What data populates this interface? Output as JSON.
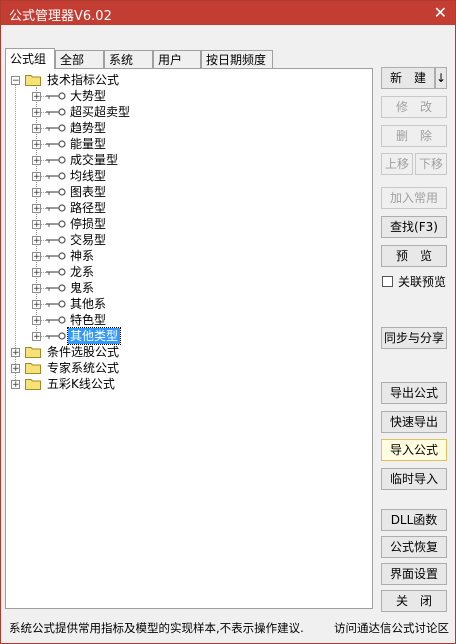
{
  "window": {
    "title": "公式管理器V6.02",
    "close_glyph": "✕"
  },
  "tabs": [
    {
      "label": "公式组",
      "active": true
    },
    {
      "label": "全部",
      "active": false
    },
    {
      "label": "系统",
      "active": false
    },
    {
      "label": "用户",
      "active": false
    },
    {
      "label": "按日期频度",
      "active": false
    }
  ],
  "tree": {
    "expanded_glyph": "−",
    "collapsed_glyph": "+",
    "groups": [
      {
        "label": "技术指标公式",
        "expanded": true,
        "children": [
          "大势型",
          "超买超卖型",
          "趋势型",
          "能量型",
          "成交量型",
          "均线型",
          "图表型",
          "路径型",
          "停损型",
          "交易型",
          "神系",
          "龙系",
          "鬼系",
          "其他系",
          "特色型",
          "其他类型"
        ],
        "selected_child": "其他类型"
      },
      {
        "label": "条件选股公式",
        "expanded": false
      },
      {
        "label": "专家系统公式",
        "expanded": false
      },
      {
        "label": "五彩K线公式",
        "expanded": false
      }
    ]
  },
  "buttons": {
    "new": "新　建",
    "new_arrow": "↓",
    "edit": "修　改",
    "delete": "删　除",
    "move_up": "上移",
    "move_down": "下移",
    "add_common": "加入常用",
    "find": "查找(F3)",
    "preview": "预　览",
    "link_preview_label": "关联预览",
    "sync_share": "同步与分享",
    "export": "导出公式",
    "quick_export": "快速导出",
    "import": "导入公式",
    "temp_import": "临时导入",
    "dll": "DLL函数",
    "restore": "公式恢复",
    "ui_settings": "界面设置",
    "close": "关　闭"
  },
  "status": {
    "text": "系统公式提供常用指标及模型的实现样本,不表示操作建议.",
    "link": "访问通达信公式讨论区"
  }
}
